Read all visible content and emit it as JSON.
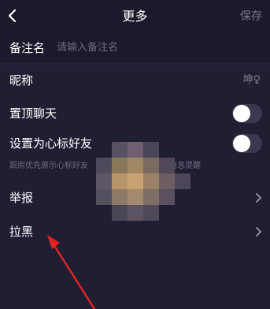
{
  "nav": {
    "title": "更多",
    "save": "保存"
  },
  "remark": {
    "label": "备注名",
    "placeholder": "请输入备注名"
  },
  "rows": {
    "nickname": {
      "label": "昵称",
      "value": "坤♀"
    },
    "pin_chat": {
      "label": "置顶聊天",
      "on": false
    },
    "close_friend": {
      "label": "设置为心标好友",
      "on": false,
      "hint": "跟房优先展示心标好友 　　　　　　　　　有消息提醒"
    },
    "report": {
      "label": "举报"
    },
    "block": {
      "label": "拉黑"
    }
  },
  "colors": {
    "background": "#201e33",
    "arrow": "#e02424"
  },
  "icons": [
    "back-arrow-icon",
    "chevron-right-icon"
  ]
}
